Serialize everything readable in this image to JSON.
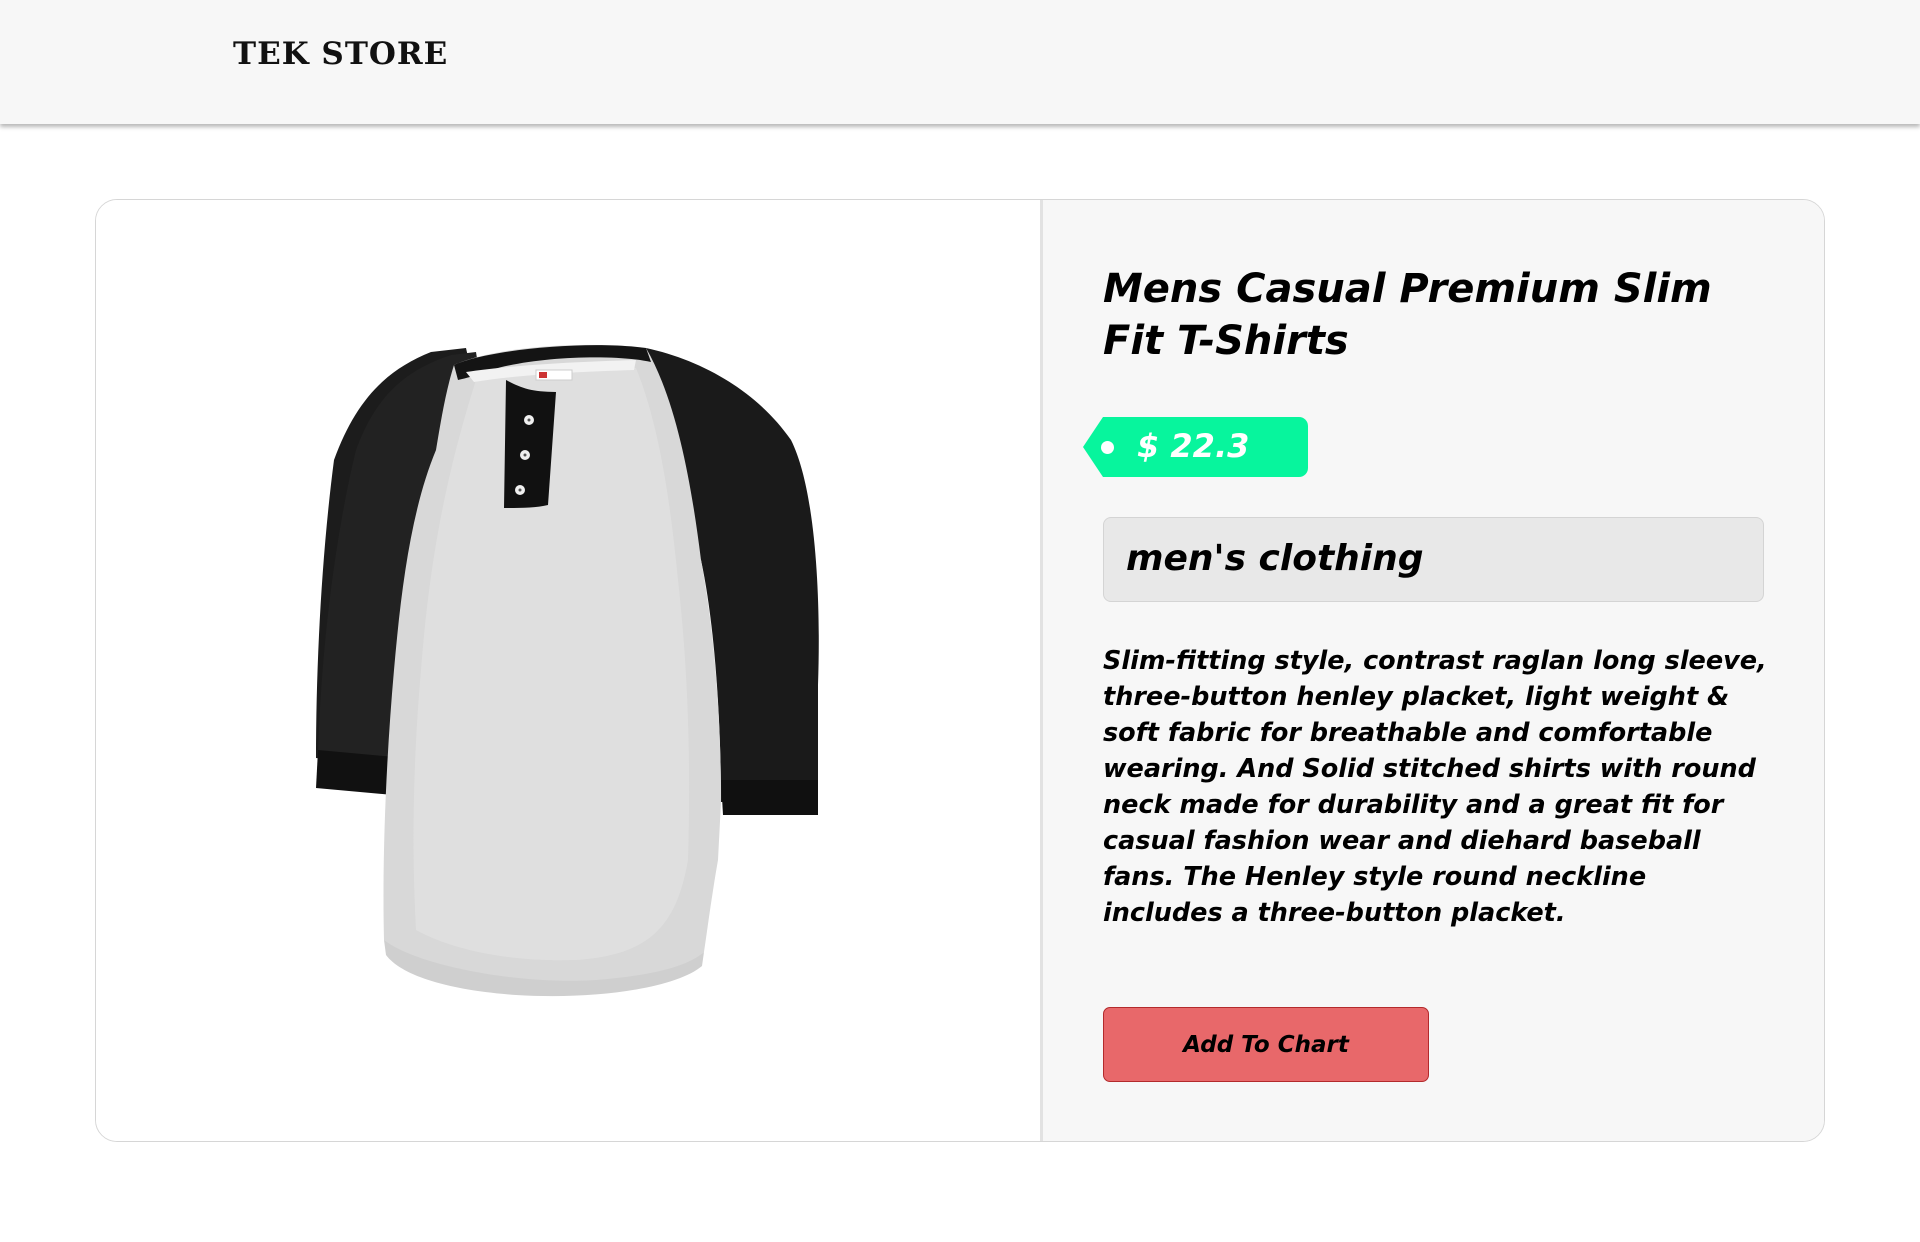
{
  "navbar": {
    "brand": "TEK STORE"
  },
  "product": {
    "image_alt": "Grey raglan henley t-shirt with black three-quarter sleeves",
    "title": "Mens Casual Premium Slim Fit T-Shirts",
    "price": "$ 22.3",
    "category": "men's clothing",
    "description": "Slim-fitting style, contrast raglan long sleeve, three-button henley placket, light weight & soft fabric for breathable and comfortable wearing. And Solid stitched shirts with round neck made for durability and a great fit for casual fashion wear and diehard baseball fans. The Henley style round neckline includes a three-button placket.",
    "add_button_label": "Add To Chart"
  },
  "colors": {
    "price_tag": "#07f59d",
    "add_button": "#e8686a",
    "info_background": "#f7f7f7",
    "category_background": "#e8e8e8"
  },
  "icons": {
    "product_image": "tshirt-image"
  }
}
